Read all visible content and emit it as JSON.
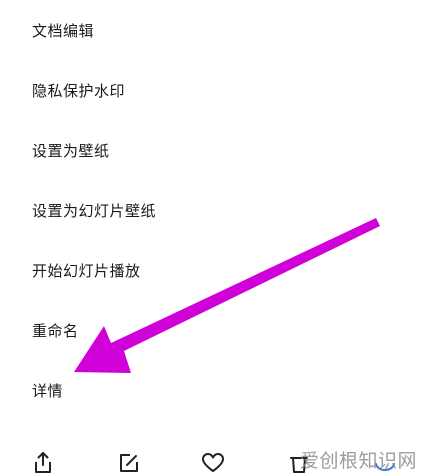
{
  "menu": {
    "items": [
      {
        "label": "文档编辑"
      },
      {
        "label": "隐私保护水印"
      },
      {
        "label": "设置为壁纸"
      },
      {
        "label": "设置为幻灯片壁纸"
      },
      {
        "label": "开始幻灯片播放"
      },
      {
        "label": "重命名"
      },
      {
        "label": "详情"
      }
    ]
  },
  "toolbar": {
    "icons": [
      "share-icon",
      "edit-icon",
      "favorite-icon",
      "delete-icon",
      "more-icon"
    ]
  },
  "annotation": {
    "arrow_color": "#d000d8"
  },
  "watermark": {
    "text": "爱创根知识网"
  }
}
